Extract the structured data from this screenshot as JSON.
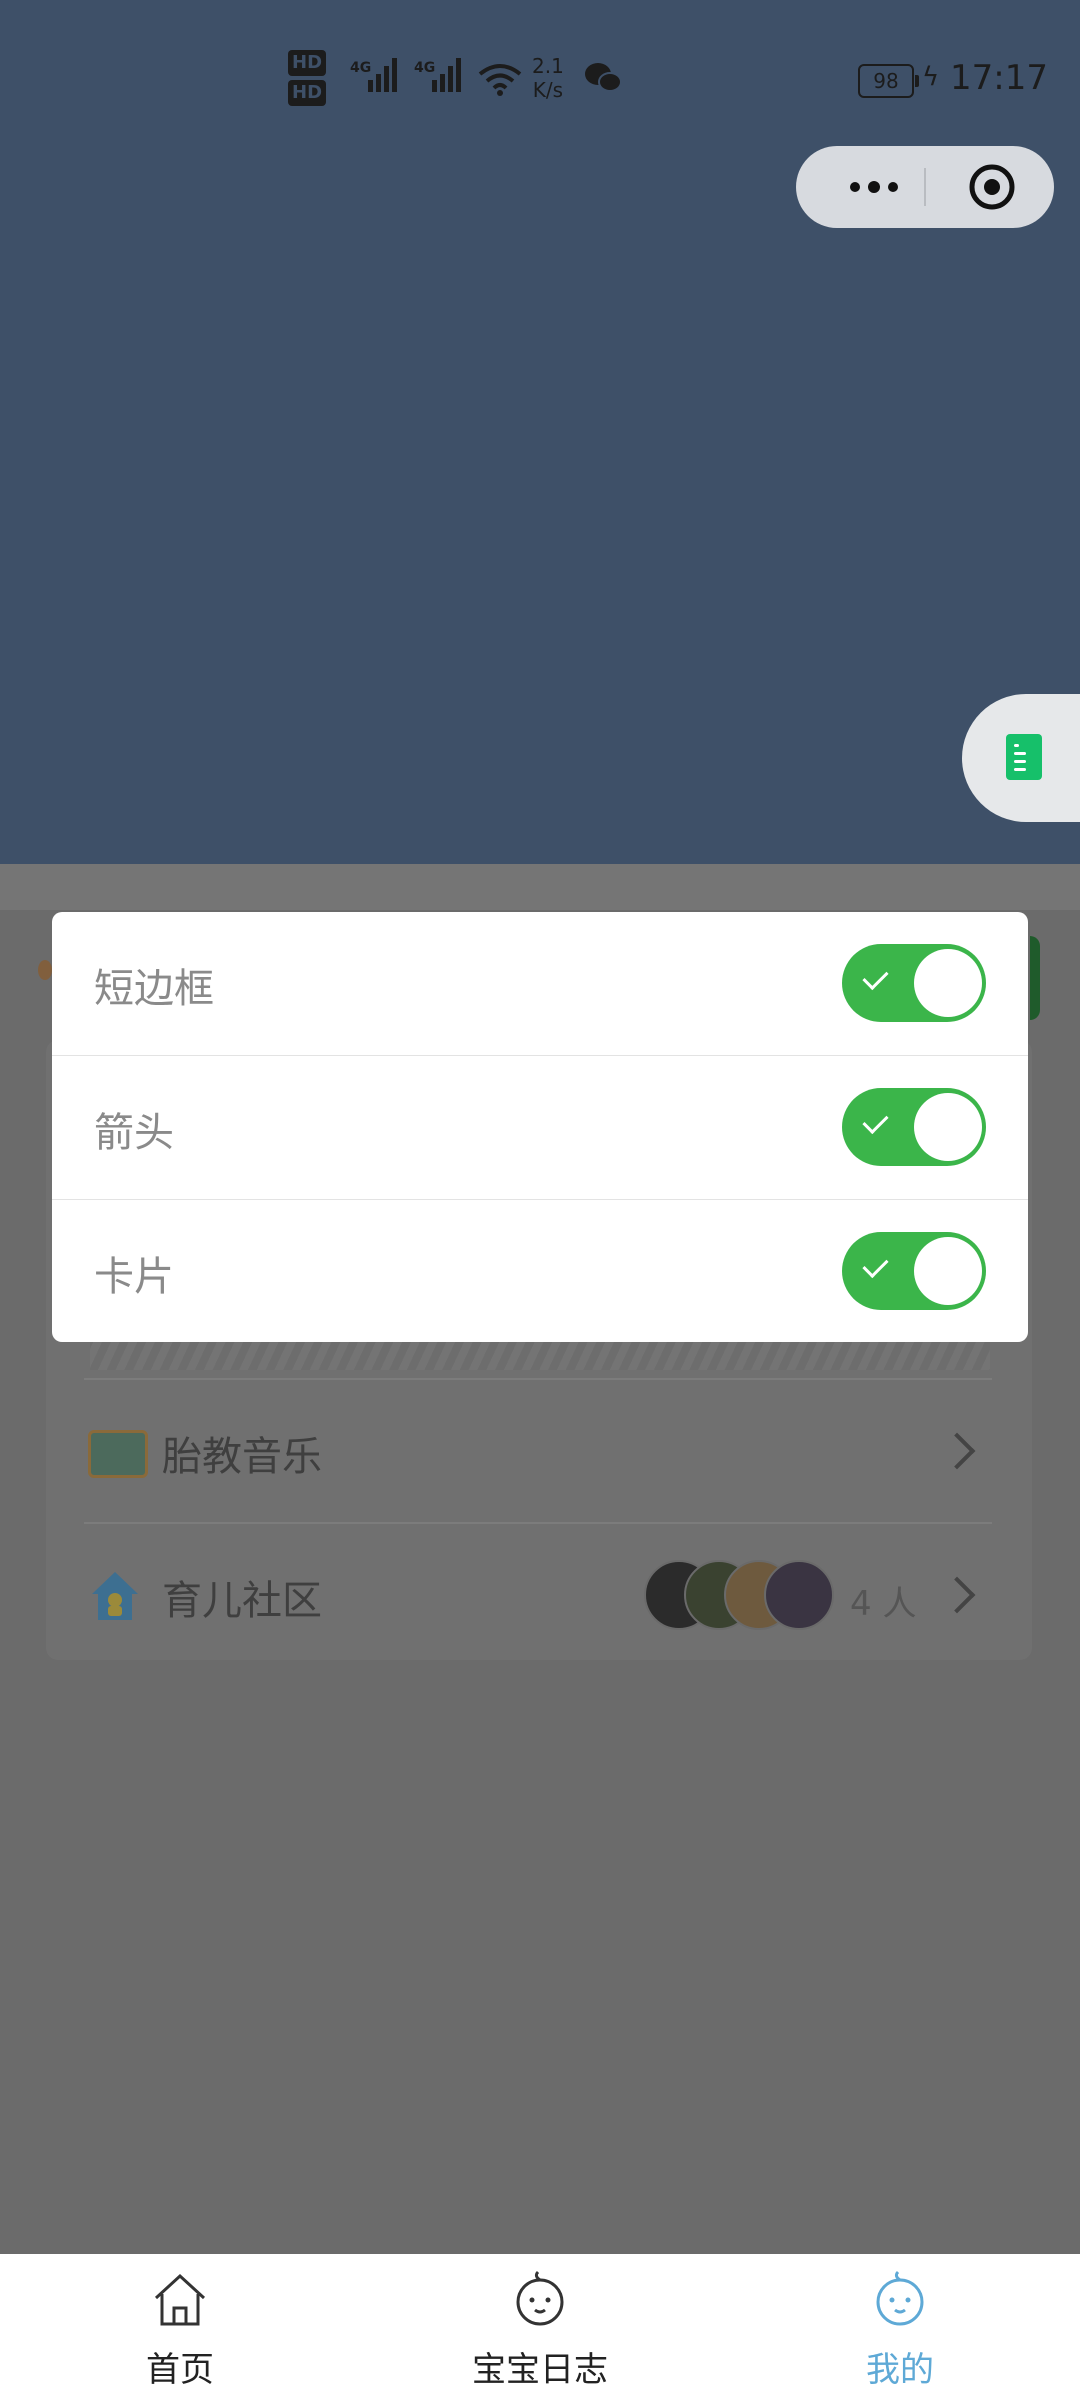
{
  "status_bar": {
    "hd1": "HD",
    "hd2": "HD",
    "net1": "4G",
    "net2": "4G",
    "speed_value": "2.1",
    "speed_unit": "K/s",
    "battery": "98",
    "time": "17:17"
  },
  "settings_sheet": {
    "rows": [
      {
        "label": "短边框",
        "on": true
      },
      {
        "label": "箭头",
        "on": true
      },
      {
        "label": "卡片",
        "on": true
      }
    ]
  },
  "background_list": {
    "music_label": "胎教音乐",
    "community_label": "育儿社区",
    "community_count": "4 人"
  },
  "tabbar": {
    "tabs": [
      {
        "label": "首页",
        "icon": "home-icon"
      },
      {
        "label": "宝宝日志",
        "icon": "baby-face-icon"
      },
      {
        "label": "我的",
        "icon": "baby-face-icon",
        "active": true
      }
    ],
    "active_color": "#5ea9d6"
  },
  "colors": {
    "header": "#3e5068",
    "switch_on": "#3bb54a",
    "overlay": "#6b6b6b",
    "float_doc": "#16c06a"
  }
}
